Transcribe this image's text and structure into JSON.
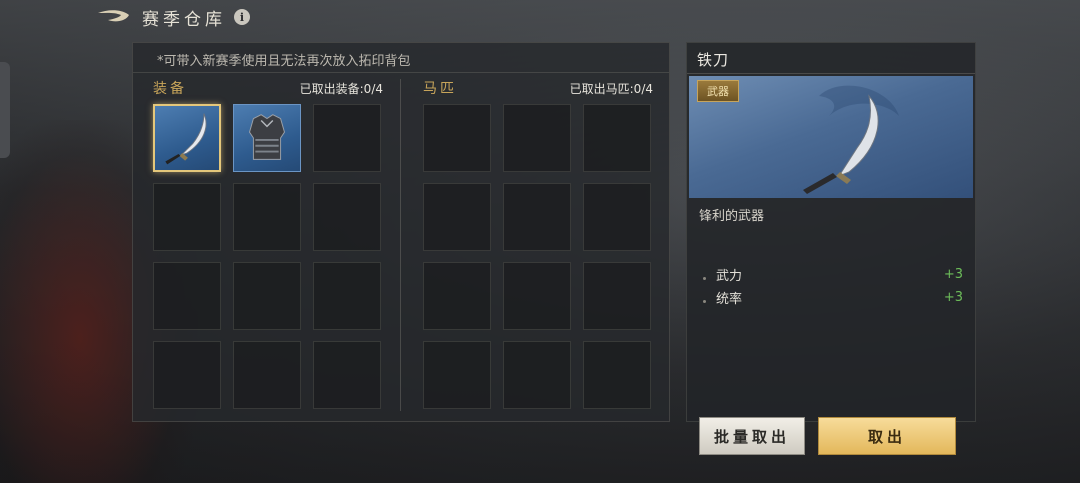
{
  "header": {
    "title": "赛季仓库",
    "info_symbol": "i"
  },
  "notice": "*可带入新赛季使用且无法再次放入拓印背包",
  "equipment": {
    "title": "装备",
    "count_label": "已取出装备:0/4",
    "slots": [
      {
        "item": "sword-icon",
        "selected": true
      },
      {
        "item": "armor-icon",
        "selected": false
      },
      {
        "item": null
      },
      {
        "item": null
      },
      {
        "item": null
      },
      {
        "item": null
      },
      {
        "item": null
      },
      {
        "item": null
      },
      {
        "item": null
      },
      {
        "item": null
      },
      {
        "item": null
      },
      {
        "item": null
      }
    ]
  },
  "horses": {
    "title": "马匹",
    "count_label": "已取出马匹:0/4",
    "slots": 12
  },
  "detail": {
    "name": "铁刀",
    "type_badge": "武器",
    "description": "锋利的武器",
    "stats": [
      {
        "label": "武力",
        "value": "+3"
      },
      {
        "label": "统率",
        "value": "+3"
      }
    ]
  },
  "buttons": {
    "batch_take": "批量取出",
    "take": "取出"
  },
  "colors": {
    "accent_gold": "#c8a55a",
    "stat_positive": "#6dbe5a",
    "item_rarity_blue": "#2e5b8e"
  }
}
